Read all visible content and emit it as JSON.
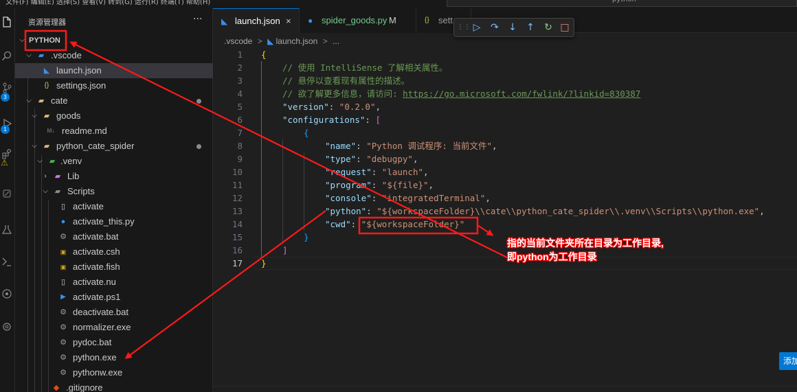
{
  "menubar": {
    "text": "文件(F)  编辑(E)  选择(S)  查看(V)  转到(G)  运行(R)  终端(T)  帮助(H)",
    "search": "python"
  },
  "activity": {
    "icons": [
      "files-icon",
      "search-icon",
      "source-control-icon",
      "run-debug-icon",
      "warning-icon",
      "extensions-icon",
      "testing-icon",
      "remote-icon",
      "account-icon",
      "settings-icon"
    ],
    "scm_badge": "3",
    "debug_badge": "1"
  },
  "sidebar": {
    "title": "资源管理器",
    "more": "···",
    "root": "PYTHON",
    "items": [
      {
        "label": ".vscode",
        "icon": "vscode-folder-icon"
      },
      {
        "label": "launch.json",
        "icon": "vscode-file-icon"
      },
      {
        "label": "settings.json",
        "icon": "json-icon"
      },
      {
        "label": "cate",
        "icon": "folder-icon"
      },
      {
        "label": "goods",
        "icon": "folder-icon"
      },
      {
        "label": "readme.md",
        "icon": "markdown-icon"
      },
      {
        "label": "python_cate_spider",
        "icon": "folder-icon"
      },
      {
        "label": ".venv",
        "icon": "venv-folder-icon"
      },
      {
        "label": "Lib",
        "icon": "lib-folder-icon"
      },
      {
        "label": "Scripts",
        "icon": "folder-icon"
      },
      {
        "label": "activate",
        "icon": "file-icon"
      },
      {
        "label": "activate_this.py",
        "icon": "python-icon"
      },
      {
        "label": "activate.bat",
        "icon": "gear-file-icon"
      },
      {
        "label": "activate.csh",
        "icon": "terminal-file-icon"
      },
      {
        "label": "activate.fish",
        "icon": "terminal-file-icon"
      },
      {
        "label": "activate.nu",
        "icon": "file-icon"
      },
      {
        "label": "activate.ps1",
        "icon": "powershell-icon"
      },
      {
        "label": "deactivate.bat",
        "icon": "gear-file-icon"
      },
      {
        "label": "normalizer.exe",
        "icon": "gear-file-icon"
      },
      {
        "label": "pydoc.bat",
        "icon": "gear-file-icon"
      },
      {
        "label": "python.exe",
        "icon": "gear-file-icon"
      },
      {
        "label": "pythonw.exe",
        "icon": "gear-file-icon"
      },
      {
        "label": ".gitignore",
        "icon": "git-icon"
      }
    ]
  },
  "tabs": [
    {
      "label": "launch.json",
      "close": "×",
      "icon": "vscode-file-icon"
    },
    {
      "label": "spider_goods.py",
      "status": "M",
      "icon": "python-icon"
    },
    {
      "label": "sett",
      "icon": "json-icon"
    }
  ],
  "breadcrumb": {
    "folder": ".vscode",
    "sep": ">",
    "file": "launch.json",
    "tail": "..."
  },
  "code": {
    "line_numbers": [
      "1",
      "2",
      "3",
      "4",
      "5",
      "6",
      "7",
      "8",
      "9",
      "10",
      "11",
      "12",
      "13",
      "14",
      "15",
      "16",
      "17"
    ],
    "l1": "{",
    "l2": "// 使用 IntelliSense 了解相关属性。",
    "l3": "// 悬停以查看现有属性的描述。",
    "l4_a": "// 欲了解更多信息，请访问: ",
    "l4_link": "https://go.microsoft.com/fwlink/?linkid=830387",
    "l5_k": "\"version\"",
    "l5_v": "\"0.2.0\"",
    "l6_k": "\"configurations\"",
    "l6_b": "[",
    "l7": "{",
    "l8_k": "\"name\"",
    "l8_v": "\"Python 调试程序: 当前文件\"",
    "l9_k": "\"type\"",
    "l9_v": "\"debugpy\"",
    "l10_k": "\"request\"",
    "l10_v": "\"launch\"",
    "l11_k": "\"program\"",
    "l11_v": "\"${file}\"",
    "l12_k": "\"console\"",
    "l12_v": "\"integratedTerminal\"",
    "l13_k": "\"python\"",
    "l13_v": "\"${workspaceFolder}\\\\cate\\\\python_cate_spider\\\\.venv\\\\Scripts\\\\python.exe\"",
    "l14_k": "\"cwd\"",
    "l14_v": "\"${workspaceFolder}\"",
    "l15": "}",
    "l16": "]",
    "l17": "}"
  },
  "annotation": {
    "line1": "指的当前文件夹所在目录为工作目录,",
    "line2": "即python为工作目录",
    "color": "#ff0000"
  },
  "add_button": "添加",
  "colors": {
    "accent": "#0078d4",
    "annotation": "#ff0000"
  }
}
